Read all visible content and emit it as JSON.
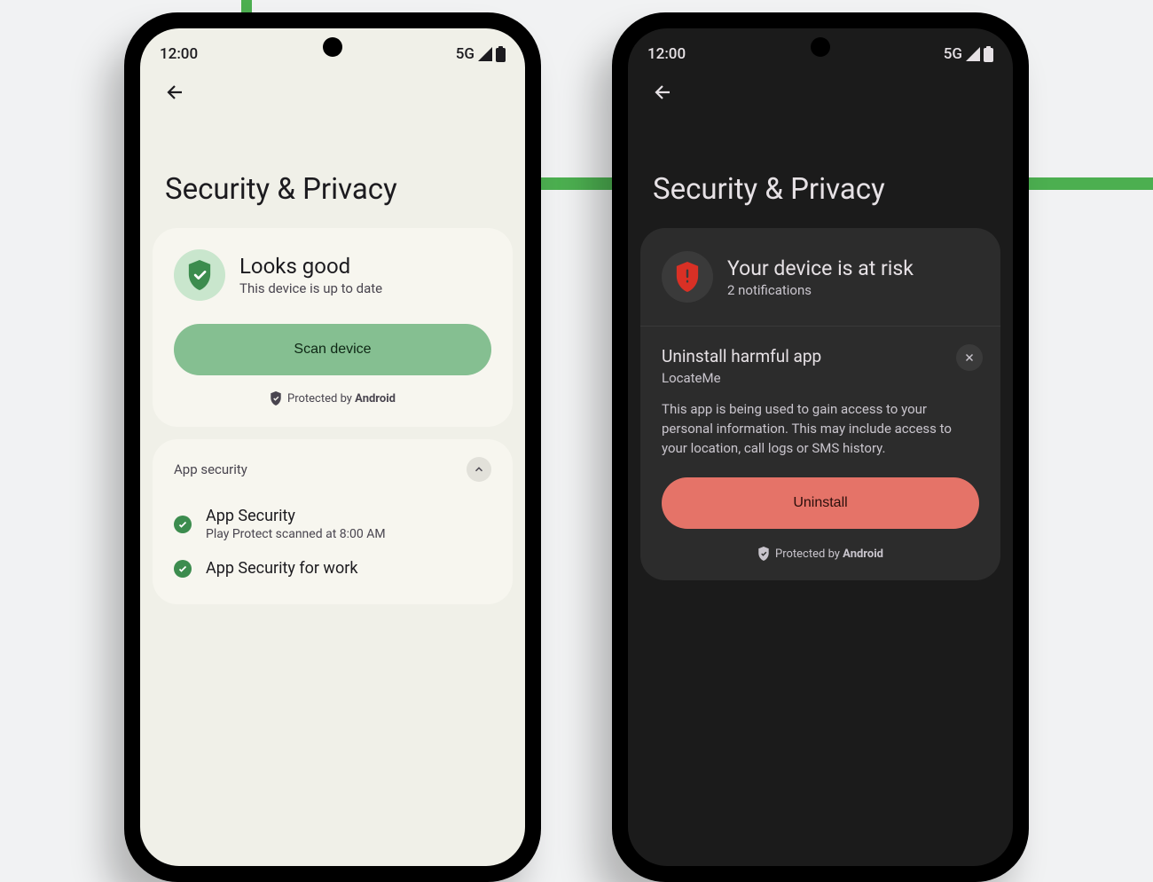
{
  "statusbar": {
    "time": "12:00",
    "network": "5G"
  },
  "page_title": "Security & Privacy",
  "light": {
    "status": {
      "title": "Looks good",
      "subtitle": "This device is up to date",
      "scan_label": "Scan device",
      "protected_prefix": "Protected by ",
      "protected_brand": "Android"
    },
    "app_security": {
      "header": "App security",
      "items": [
        {
          "title": "App Security",
          "subtitle": "Play Protect scanned at 8:00 AM"
        },
        {
          "title": "App Security for work",
          "subtitle": ""
        }
      ]
    }
  },
  "dark": {
    "risk": {
      "title": "Your device is at risk",
      "subtitle": "2 notifications"
    },
    "alert": {
      "title": "Uninstall harmful app",
      "app": "LocateMe",
      "description": "This app is being used to gain access to your personal information. This may include access to your location, call logs or SMS history.",
      "button": "Uninstall",
      "protected_prefix": "Protected by ",
      "protected_brand": "Android"
    }
  }
}
